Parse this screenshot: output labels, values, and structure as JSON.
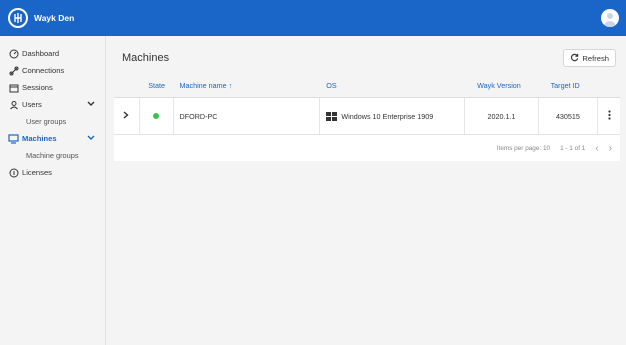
{
  "app": {
    "name": "Wayk Den"
  },
  "sidebar": {
    "items": [
      {
        "label": "Dashboard",
        "icon": "dashboard-icon"
      },
      {
        "label": "Connections",
        "icon": "connections-icon"
      },
      {
        "label": "Sessions",
        "icon": "sessions-icon"
      },
      {
        "label": "Users",
        "icon": "users-icon",
        "sub": "User groups"
      },
      {
        "label": "Machines",
        "icon": "machines-icon",
        "sub": "Machine groups",
        "active": true
      },
      {
        "label": "Licenses",
        "icon": "licenses-icon"
      }
    ]
  },
  "main": {
    "title": "Machines",
    "refresh_label": "Refresh",
    "columns": [
      "State",
      "Machine name ↑",
      "OS",
      "Wayk Version",
      "Target ID"
    ],
    "rows": [
      {
        "state": "online",
        "name": "DFORD-PC",
        "os": "Windows 10 Enterprise 1909",
        "version": "2020.1.1",
        "target_id": "430515"
      }
    ],
    "pager": {
      "items_per_page": "Items per page: 10",
      "range": "1 - 1 of 1"
    }
  },
  "colors": {
    "accent": "#1a66c8",
    "online": "#3cc24a"
  }
}
